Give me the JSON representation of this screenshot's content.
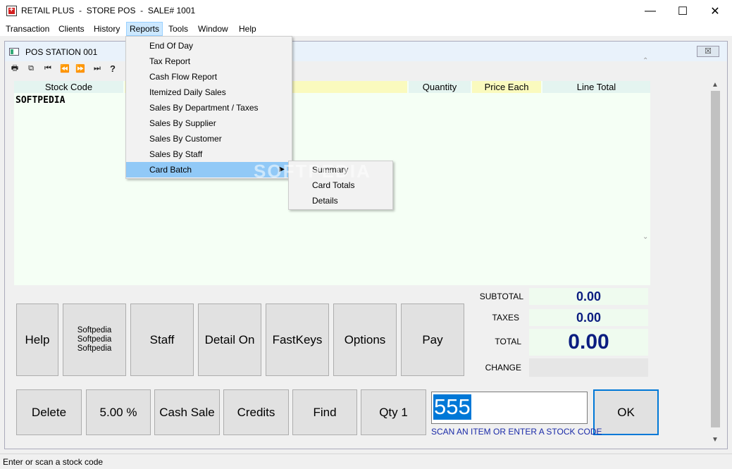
{
  "window": {
    "title": "RETAIL PLUS  -  STORE POS  -  SALE# 1001",
    "minimize": "—",
    "maximize": "☐",
    "close": "✕"
  },
  "menubar": {
    "items": [
      "Transaction",
      "Clients",
      "History",
      "Reports",
      "Tools",
      "Window",
      "Help"
    ],
    "active": "Reports"
  },
  "reports_menu": {
    "items": [
      "End Of Day",
      "Tax Report",
      "Cash Flow Report",
      "Itemized Daily Sales",
      "Sales By Department / Taxes",
      "Sales By Supplier",
      "Sales By Customer",
      "Sales By Staff",
      "Card Batch"
    ],
    "highlighted": "Card Batch"
  },
  "card_batch_submenu": {
    "items": [
      "Summary",
      "Card Totals",
      "Details"
    ]
  },
  "child_window": {
    "title": "POS STATION 001",
    "close_label": "☒"
  },
  "toolbar": {
    "icons": [
      "printer-icon",
      "copy-icon",
      "first-record-icon",
      "prev-record-icon",
      "next-record-icon",
      "last-record-icon",
      "help-question-icon"
    ],
    "glyphs": [
      "🖶",
      "⧉",
      "⏮",
      "⏪",
      "⏩",
      "⏭",
      "?"
    ]
  },
  "grid": {
    "columns": {
      "stock_code": "Stock Code",
      "description": "",
      "quantity": "Quantity",
      "price_each": "Price Each",
      "line_total": "Line Total"
    },
    "row_text": "SOFTPEDIA"
  },
  "totals": {
    "subtotal_label": "SUBTOTAL",
    "subtotal_value": "0.00",
    "taxes_label": "TAXES",
    "taxes_value": "0.00",
    "total_label": "TOTAL",
    "total_value": "0.00",
    "change_label": "CHANGE",
    "change_value": ""
  },
  "buttons_row1": {
    "help": "Help",
    "softpedia_lines": [
      "Softpedia",
      "Softpedia",
      "Softpedia"
    ],
    "staff": "Staff",
    "detail_on": "Detail On",
    "fastkeys": "FastKeys",
    "options": "Options",
    "pay": "Pay"
  },
  "buttons_row2": {
    "delete": "Delete",
    "percent": "5.00 %",
    "cash_sale": "Cash Sale",
    "credits": "Credits",
    "find": "Find",
    "qty": "Qty 1",
    "ok": "OK"
  },
  "entry": {
    "value": "555",
    "hint": "SCAN AN ITEM OR ENTER A STOCK CODE"
  },
  "status_bar": {
    "text": "Enter or scan a stock code"
  },
  "watermark": "SOFTPEDIA",
  "colors": {
    "accent": "#0078d7",
    "totals_text": "#0b1d80",
    "menu_highlight": "#91c9f7",
    "grid_bg": "#f5fff5"
  }
}
